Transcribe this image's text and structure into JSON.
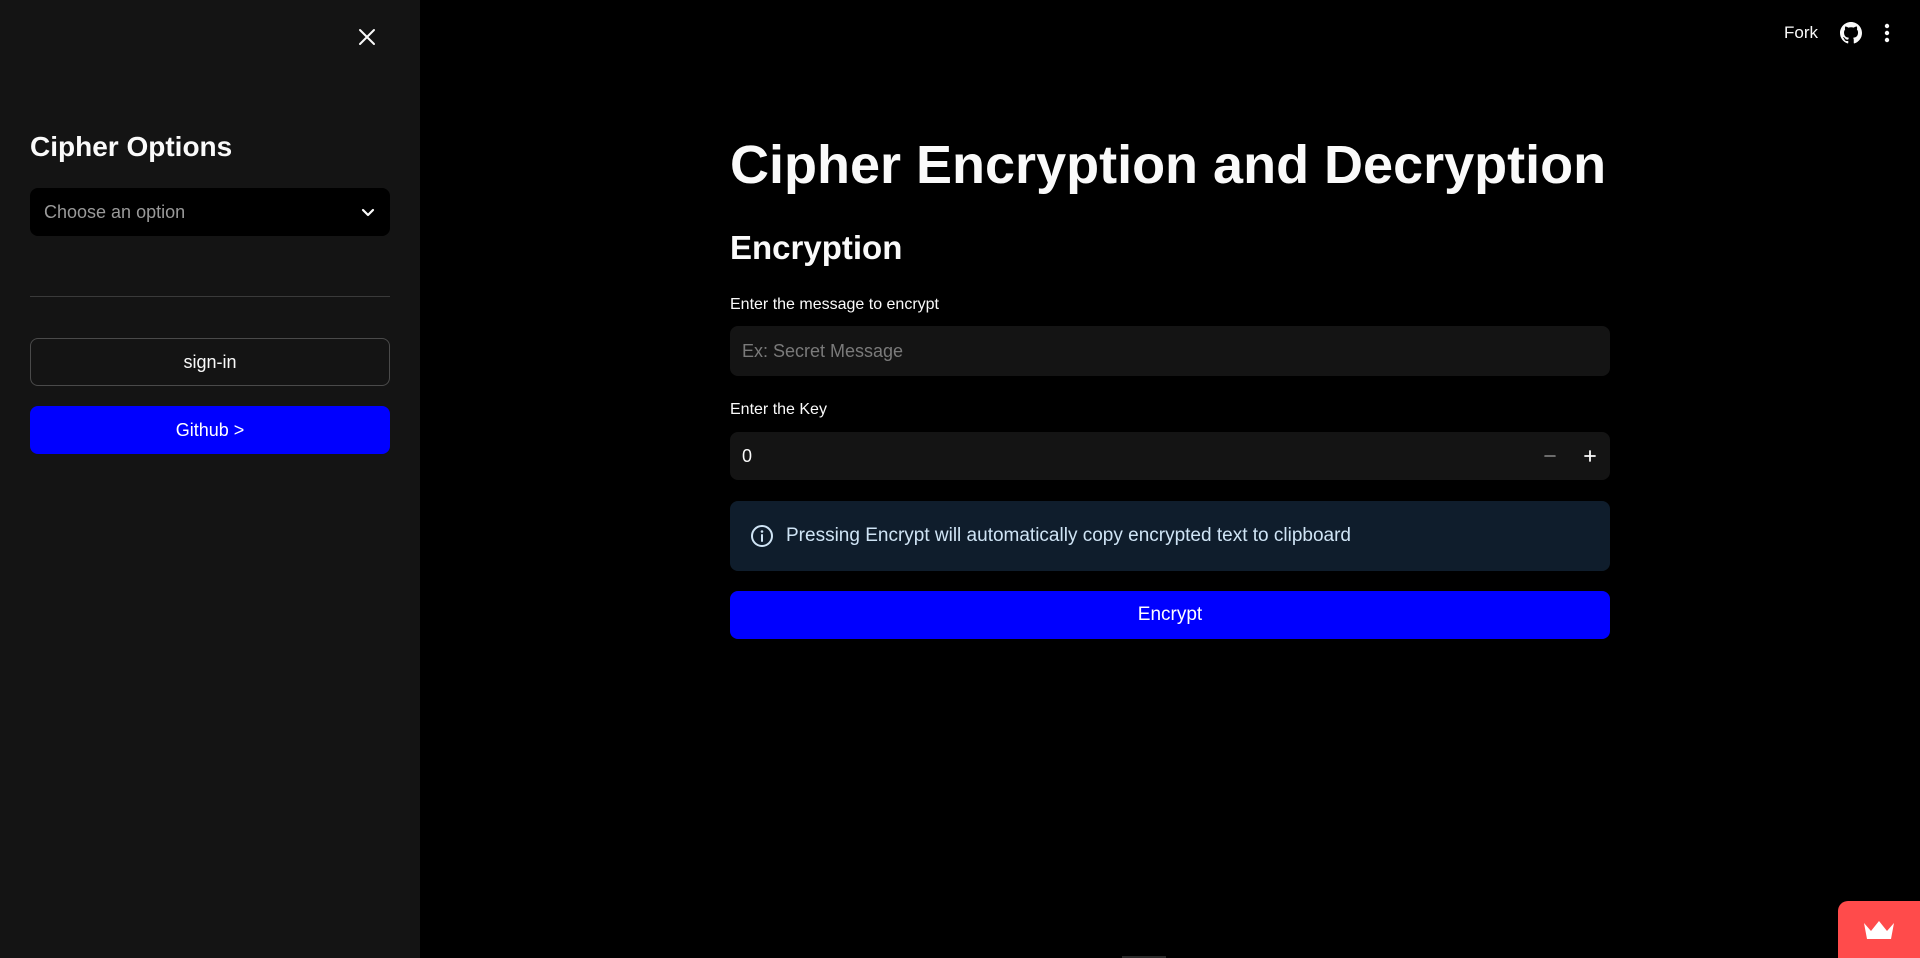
{
  "sidebar": {
    "title": "Cipher Options",
    "select": {
      "placeholder": "Choose an option"
    },
    "signin_label": "sign-in",
    "github_label": "Github >"
  },
  "header": {
    "fork_label": "Fork"
  },
  "main": {
    "title": "Cipher Encryption and Decryption",
    "section_title": "Encryption",
    "message_label": "Enter the message to encrypt",
    "message_placeholder": "Ex: Secret Message",
    "message_value": "",
    "key_label": "Enter the Key",
    "key_value": "0",
    "info_text": "Pressing Encrypt will automatically copy encrypted text to clipboard",
    "encrypt_label": "Encrypt"
  },
  "icons": {
    "close": "close-icon",
    "chevron": "chevron-down-icon",
    "github": "github-icon",
    "menu": "more-vertical-icon",
    "info": "info-icon",
    "minus": "minus-icon",
    "plus": "plus-icon",
    "badge": "crown-icon"
  },
  "colors": {
    "accent": "#0000ff",
    "sidebar_bg": "#141414",
    "page_bg": "#000000",
    "info_bg": "#0f1d2c",
    "badge": "#ff4b4b"
  }
}
